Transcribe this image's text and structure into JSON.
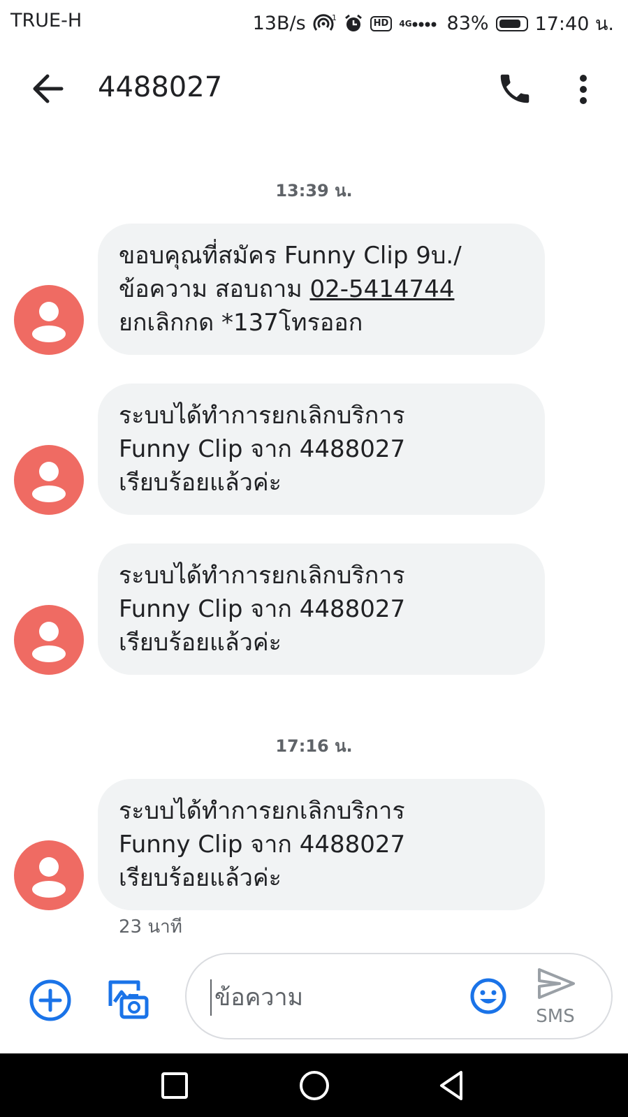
{
  "status_bar": {
    "carrier": "TRUE-H",
    "net_speed": "13B/s",
    "hotspot_count": "1",
    "hd_label": "HD",
    "network": "4G",
    "battery": "83%",
    "battery_level": 0.83,
    "time": "17:40 น."
  },
  "toolbar": {
    "title": "4488027",
    "icons": {
      "back": "arrow-back-icon",
      "call": "phone-icon",
      "more": "more-vert-icon"
    }
  },
  "timestamps": [
    "13:39 น.",
    "17:16 น."
  ],
  "messages": [
    {
      "lines": [
        "ขอบคุณที่สมัคร Funny Clip 9บ./",
        "ข้อความ สอบถาม ",
        "ยกเลิกกด *137โทรออก"
      ],
      "link": "02-5414744"
    },
    {
      "lines": [
        "ระบบได้ทำการยกเลิกบริการ",
        "Funny Clip จาก 4488027",
        "เรียบร้อยแล้วค่ะ"
      ]
    },
    {
      "lines": [
        "ระบบได้ทำการยกเลิกบริการ",
        "Funny Clip จาก 4488027",
        "เรียบร้อยแล้วค่ะ"
      ]
    },
    {
      "lines": [
        "ระบบได้ทำการยกเลิกบริการ",
        "Funny Clip จาก 4488027",
        "เรียบร้อยแล้วค่ะ"
      ]
    }
  ],
  "last_message_time": "23 นาที",
  "compose": {
    "placeholder": "ข้อความ",
    "send_label": "SMS"
  },
  "colors": {
    "avatar": "#ef6b63",
    "bubble": "#f1f3f4",
    "accent": "#1a73e8",
    "nav_bar": "#000000"
  }
}
